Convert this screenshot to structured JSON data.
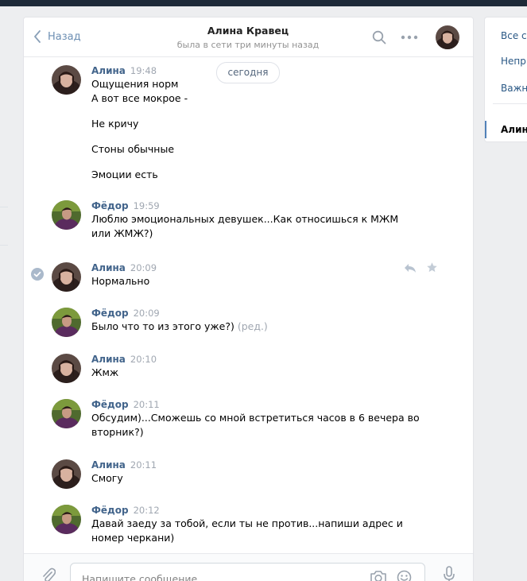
{
  "header": {
    "back_label": "Назад",
    "contact_name": "Алина Кравец",
    "status": "была в сети три минуты назад"
  },
  "date_separator": "сегодня",
  "messages": [
    {
      "author": "Алина",
      "time": "19:48",
      "lines": [
        "Ощущения норм",
        "А вот все мокрое -",
        "Не кричу",
        "Стоны обычные",
        "Эмоции есть"
      ]
    },
    {
      "author": "Фёдор",
      "time": "19:59",
      "lines": [
        "Люблю эмоциональных девушек...Как относишься к МЖМ",
        "или ЖМЖ?)"
      ]
    },
    {
      "author": "Алина",
      "time": "20:09",
      "lines": [
        "Нормально"
      ]
    },
    {
      "author": "Фёдор",
      "time": "20:09",
      "lines": [
        "Было что то из этого уже?)"
      ],
      "edited": "(ред.)"
    },
    {
      "author": "Алина",
      "time": "20:10",
      "lines": [
        "Жмж"
      ]
    },
    {
      "author": "Фёдор",
      "time": "20:11",
      "lines": [
        "Обсудим)...Сможешь со мной встретиться часов в 6 вечера во",
        "вторник?)"
      ]
    },
    {
      "author": "Алина",
      "time": "20:11",
      "lines": [
        "Смогу"
      ]
    },
    {
      "author": "Фёдор",
      "time": "20:12",
      "lines": [
        "Давай заеду за тобой, если ты не против...напиши адрес и",
        "номер черкани)"
      ]
    }
  ],
  "composer": {
    "placeholder": "Напишите сообщение..."
  },
  "right_panel": {
    "items": [
      "Все с",
      "Непр",
      "Важн"
    ],
    "active": "Алин"
  },
  "colors": {
    "background": "#edeef0",
    "link": "#42648b",
    "meta_gray": "#a0a7b1",
    "accent": "#5181b8"
  }
}
